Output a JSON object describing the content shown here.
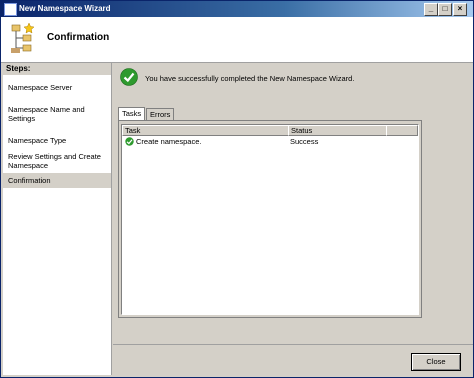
{
  "window": {
    "title": "New Namespace Wizard"
  },
  "header": {
    "title": "Confirmation"
  },
  "sidebar": {
    "title": "Steps:",
    "items": [
      {
        "label": "Namespace Server"
      },
      {
        "label": "Namespace Name and Settings"
      },
      {
        "label": "Namespace Type"
      },
      {
        "label": "Review Settings and Create Namespace"
      },
      {
        "label": "Confirmation"
      }
    ]
  },
  "main": {
    "message": "You have successfully completed the New Namespace Wizard.",
    "tabs": [
      {
        "label": "Tasks"
      },
      {
        "label": "Errors"
      }
    ],
    "columns": [
      "Task",
      "Status"
    ],
    "rows": [
      {
        "task": "Create namespace.",
        "status": "Success"
      }
    ]
  },
  "buttons": {
    "close": "Close"
  },
  "colors": {
    "title_bar": "#0a246a",
    "success": "#2e9a2e",
    "window_bg": "#d4d0c8"
  }
}
